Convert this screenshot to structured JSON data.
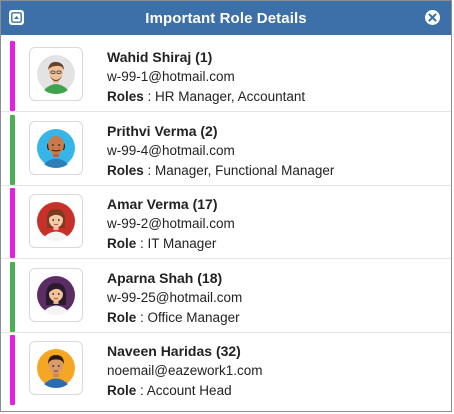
{
  "window": {
    "title": "Important Role Details",
    "minimize_icon": "collapse-icon",
    "close_icon": "close-icon",
    "header_color": "#3d6fa8"
  },
  "people": [
    {
      "name": "Wahid Shiraj (1)",
      "email": "w-99-1@hotmail.com",
      "role_label": "Roles",
      "roles": "HR Manager, Accountant",
      "stripe_color": "#e81ee0",
      "avatar_icon": "male-avatar-icon",
      "avatar_bg": "#e3e3e3"
    },
    {
      "name": "Prithvi Verma (2)",
      "email": "w-99-4@hotmail.com",
      "role_label": "Roles",
      "roles": "Manager, Functional Manager",
      "stripe_color": "#4caf50",
      "avatar_icon": "bald-male-avatar-icon",
      "avatar_bg": "#36b5e8"
    },
    {
      "name": "Amar Verma (17)",
      "email": "w-99-2@hotmail.com",
      "role_label": "Role",
      "roles": "IT Manager",
      "stripe_color": "#e81ee0",
      "avatar_icon": "female-avatar-icon",
      "avatar_bg": "#c8312b"
    },
    {
      "name": "Aparna Shah (18)",
      "email": "w-99-25@hotmail.com",
      "role_label": "Role",
      "roles": "Office Manager",
      "stripe_color": "#4caf50",
      "avatar_icon": "female-avatar-icon",
      "avatar_bg": "#5a2d63"
    },
    {
      "name": "Naveen Haridas (32)",
      "email": "noemail@eazework1.com",
      "role_label": "Role",
      "roles": "Account Head",
      "stripe_color": "#e81ee0",
      "avatar_icon": "male-avatar-icon",
      "avatar_bg": "#f5a623"
    }
  ]
}
